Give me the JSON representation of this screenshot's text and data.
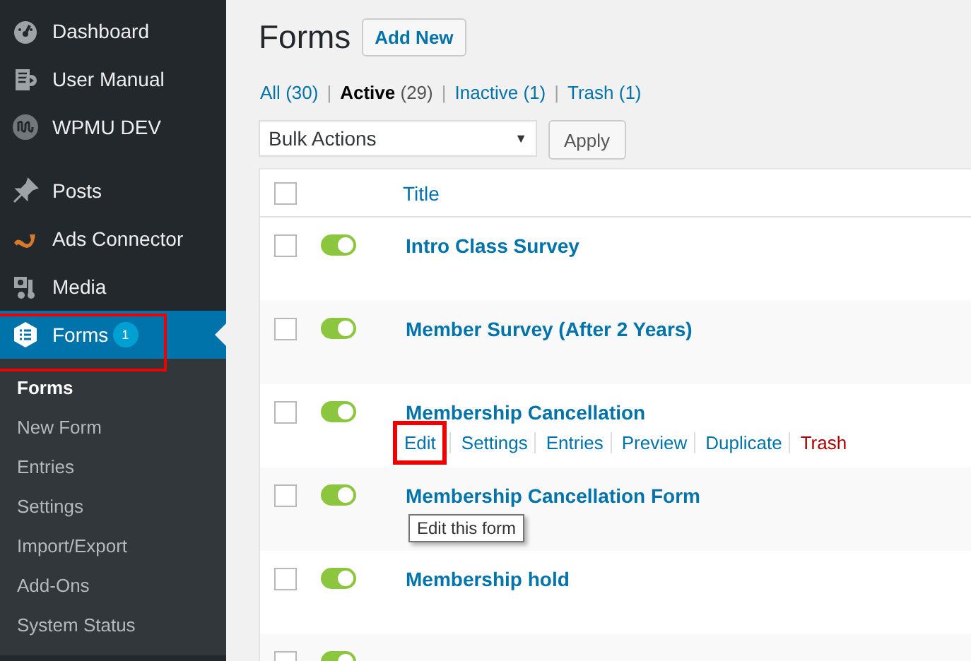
{
  "sidebar": {
    "items": [
      {
        "label": "Dashboard",
        "kind": "gauge",
        "selected": false
      },
      {
        "label": "User Manual",
        "kind": "book",
        "selected": false
      },
      {
        "label": "WPMU DEV",
        "kind": "wpmu",
        "selected": false,
        "gap_after": true
      },
      {
        "label": "Posts",
        "kind": "pin",
        "selected": false
      },
      {
        "label": "Ads Connector",
        "kind": "ads",
        "selected": false
      },
      {
        "label": "Media",
        "kind": "media",
        "selected": false
      },
      {
        "label": "Forms",
        "kind": "forms",
        "selected": true,
        "badge": "1",
        "highlighted": true
      }
    ],
    "submenu": [
      {
        "label": "Forms",
        "selected": true
      },
      {
        "label": "New Form",
        "selected": false
      },
      {
        "label": "Entries",
        "selected": false
      },
      {
        "label": "Settings",
        "selected": false
      },
      {
        "label": "Import/Export",
        "selected": false
      },
      {
        "label": "Add-Ons",
        "selected": false
      },
      {
        "label": "System Status",
        "selected": false
      }
    ]
  },
  "page": {
    "title": "Forms",
    "add_button": "Add New",
    "filters": [
      {
        "label": "All",
        "count": "(30)",
        "selected": false
      },
      {
        "label": "Active",
        "count": "(29)",
        "selected": true
      },
      {
        "label": "Inactive",
        "count": "(1)",
        "selected": false
      },
      {
        "label": "Trash",
        "count": "(1)",
        "selected": false
      }
    ],
    "filter_separator": "|",
    "bulk_select": {
      "value": "Bulk Actions",
      "caret": "▼"
    },
    "apply_button": "Apply"
  },
  "table": {
    "columns": [
      "Title"
    ],
    "select_all_checked": false,
    "rows": [
      {
        "title": "Intro Class Survey",
        "checked": false,
        "on": true
      },
      {
        "title": "Member Survey (After 2 Years)",
        "checked": false,
        "on": true
      },
      {
        "title": "Membership Cancellation",
        "checked": false,
        "on": true,
        "actions": [
          {
            "label": "Edit",
            "kind": "link",
            "highlighted": true,
            "tooltip": "Edit this form"
          },
          {
            "label": "Settings",
            "kind": "link",
            "highlighted": false
          },
          {
            "label": "Entries",
            "kind": "link",
            "highlighted": false
          },
          {
            "label": "Preview",
            "kind": "link",
            "highlighted": false
          },
          {
            "label": "Duplicate",
            "kind": "link",
            "highlighted": false
          },
          {
            "label": "Trash",
            "kind": "delete",
            "highlighted": false
          }
        ]
      },
      {
        "title": "Membership Cancellation Form",
        "checked": false,
        "on": true
      },
      {
        "title": "Membership hold",
        "checked": false,
        "on": true
      },
      {
        "checked": false,
        "on": true
      }
    ]
  }
}
